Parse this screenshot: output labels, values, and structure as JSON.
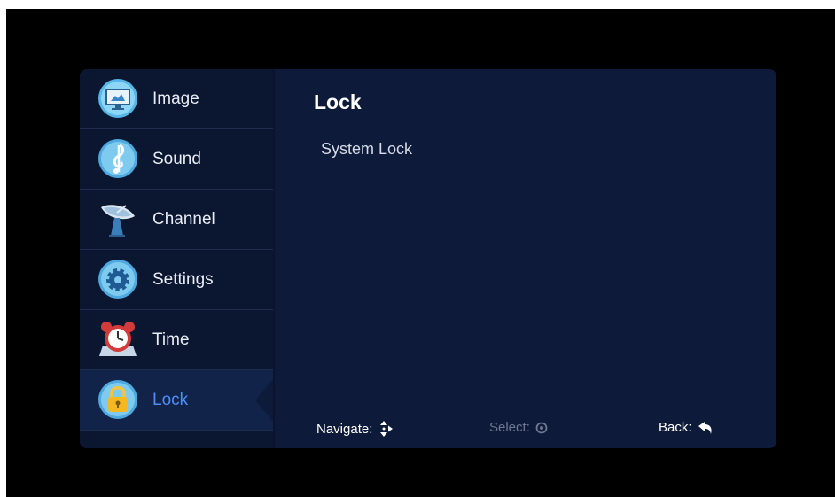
{
  "sidebar": {
    "items": [
      {
        "label": "Image",
        "icon": "monitor-icon"
      },
      {
        "label": "Sound",
        "icon": "music-note-icon"
      },
      {
        "label": "Channel",
        "icon": "satellite-dish-icon"
      },
      {
        "label": "Settings",
        "icon": "gear-icon"
      },
      {
        "label": "Time",
        "icon": "alarm-clock-icon"
      },
      {
        "label": "Lock",
        "icon": "padlock-icon",
        "selected": true
      }
    ]
  },
  "panel": {
    "title": "Lock",
    "options": [
      "System Lock"
    ]
  },
  "footer": {
    "navigate_label": "Navigate:",
    "select_label": "Select:",
    "back_label": "Back:"
  },
  "colors": {
    "menu_background": "#0d1a39",
    "selected_text": "#4f8ef7",
    "dim_text": "#6d7894"
  }
}
